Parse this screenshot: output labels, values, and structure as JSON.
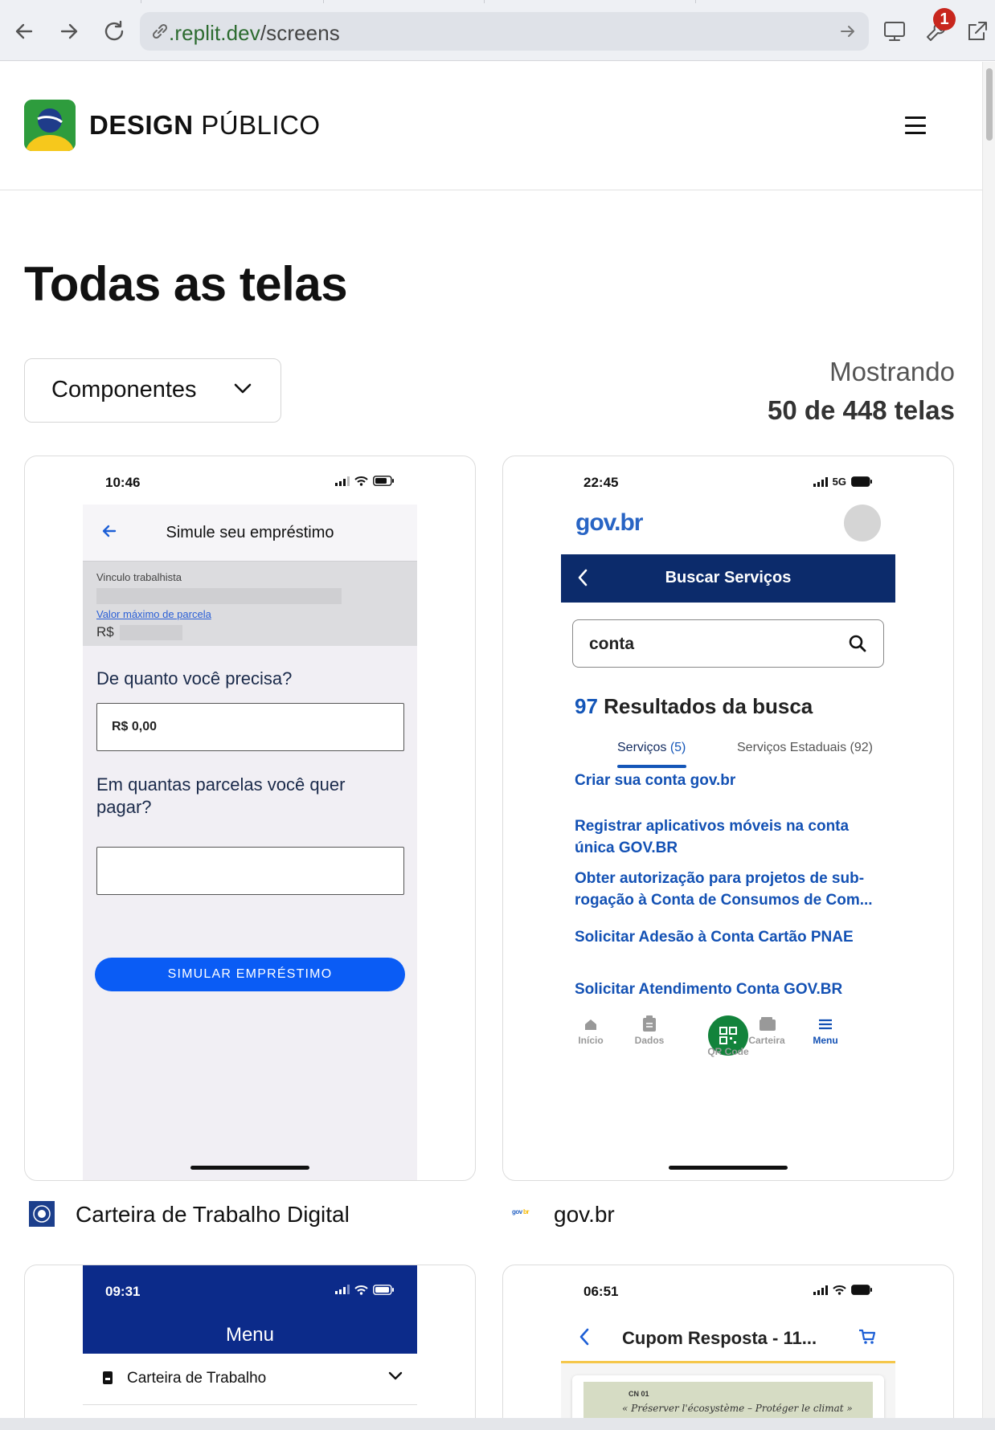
{
  "browser": {
    "url_host": ".replit.dev",
    "url_path": "/screens",
    "notification_count": "1"
  },
  "site": {
    "brand_bold": "DESIGN",
    "brand_rest": "PÚBLICO"
  },
  "main": {
    "title": "Todas as telas",
    "filter_label": "Componentes",
    "count_line1": "Mostrando",
    "count_line2": "50 de 448 telas"
  },
  "cards": [
    {
      "app_name": "Carteira de Trabalho Digital",
      "screen": {
        "time": "10:46",
        "header_title": "Simule seu empréstimo",
        "vinculo_label": "Vinculo trabalhista",
        "valor_label": "Valor máximo de parcela",
        "currency": "R$",
        "question1": "De quanto você precisa?",
        "amount_value": "R$ 0,00",
        "question2": "Em quantas parcelas você quer pagar?",
        "button_label": "SIMULAR EMPRÉSTIMO"
      }
    },
    {
      "app_name": "gov.br",
      "screen": {
        "time": "22:45",
        "network": "5G",
        "logo_text": "gov.br",
        "nav_title": "Buscar Serviços",
        "search_value": "conta",
        "results_count": "97",
        "results_label": "Resultados da busca",
        "tab1_label": "Serviços",
        "tab1_count": "(5)",
        "tab2_label": "Serviços Estaduais (92)",
        "links": [
          "Criar sua conta gov.br",
          "Registrar aplicativos móveis na conta única GOV.BR",
          "Obter autorização para projetos de sub-rogação à Conta de Consumos de Com...",
          "Solicitar Adesão à Conta Cartão PNAE",
          "Solicitar Atendimento Conta GOV.BR"
        ],
        "tabbar": [
          "Início",
          "Dados",
          "QR Code",
          "Carteira",
          "Menu"
        ]
      }
    },
    {
      "app_name": "",
      "screen": {
        "time": "09:31",
        "title": "Menu",
        "row_label": "Carteira de Trabalho"
      }
    },
    {
      "app_name": "",
      "screen": {
        "time": "06:51",
        "header_title": "Cupom Resposta - 11...",
        "coupon_code": "CN 01",
        "coupon_quote": "« Préserver l'écosystème – Protéger le climat »"
      }
    }
  ],
  "colors": {
    "govbr_blue": "#1351b4",
    "govbr_navy": "#0c2b6b",
    "ctps_button_blue": "#0a5cf5",
    "qr_green": "#12833b"
  }
}
